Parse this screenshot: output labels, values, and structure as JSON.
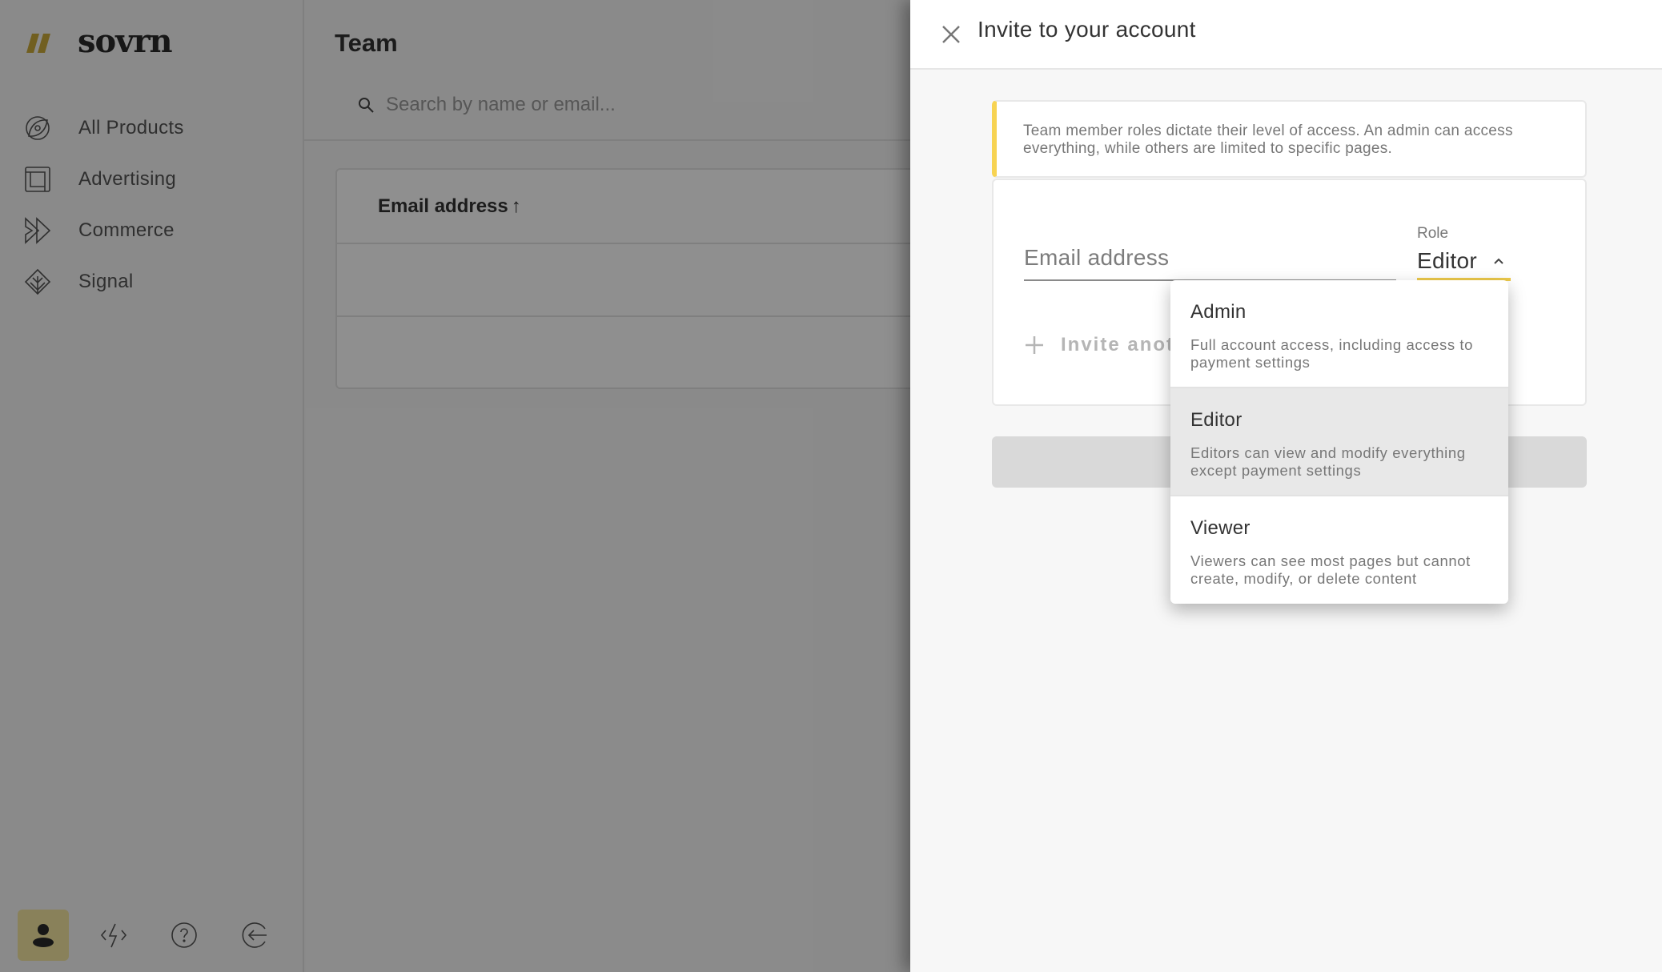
{
  "brand": {
    "name": "sovrn",
    "accent": "#f7d352",
    "active_underline": "#ecc94b"
  },
  "sidebar": {
    "items": [
      {
        "label": "All Products",
        "icon": "all-products-icon"
      },
      {
        "label": "Advertising",
        "icon": "advertising-icon"
      },
      {
        "label": "Commerce",
        "icon": "commerce-icon"
      },
      {
        "label": "Signal",
        "icon": "signal-icon"
      }
    ],
    "bottom": [
      {
        "name": "account",
        "icon": "user-icon",
        "active": true
      },
      {
        "name": "developer",
        "icon": "code-bolt-icon"
      },
      {
        "name": "help",
        "icon": "help-icon"
      },
      {
        "name": "logout",
        "icon": "logout-icon"
      }
    ]
  },
  "main": {
    "title": "Team",
    "search": {
      "placeholder": "Search by name or email...",
      "value": ""
    },
    "table": {
      "columns": [
        {
          "label": "Email address",
          "sort": "asc",
          "sort_icon": "↑"
        }
      ],
      "rows": [
        {},
        {}
      ]
    }
  },
  "drawer": {
    "title": "Invite to your account",
    "notice": "Team member roles dictate their level of access. An admin can access everything, while others are limited to specific pages.",
    "email": {
      "placeholder": "Email address",
      "value": ""
    },
    "role": {
      "label": "Role",
      "value": "Editor",
      "open": true,
      "options": [
        {
          "title": "Admin",
          "description": "Full account access, including access to payment settings"
        },
        {
          "title": "Editor",
          "description": "Editors can view and modify everything except payment settings",
          "selected": true
        },
        {
          "title": "Viewer",
          "description": "Viewers can see most pages but cannot create, modify, or delete content"
        }
      ]
    },
    "invite_another": "Invite another",
    "submit_label": ""
  }
}
